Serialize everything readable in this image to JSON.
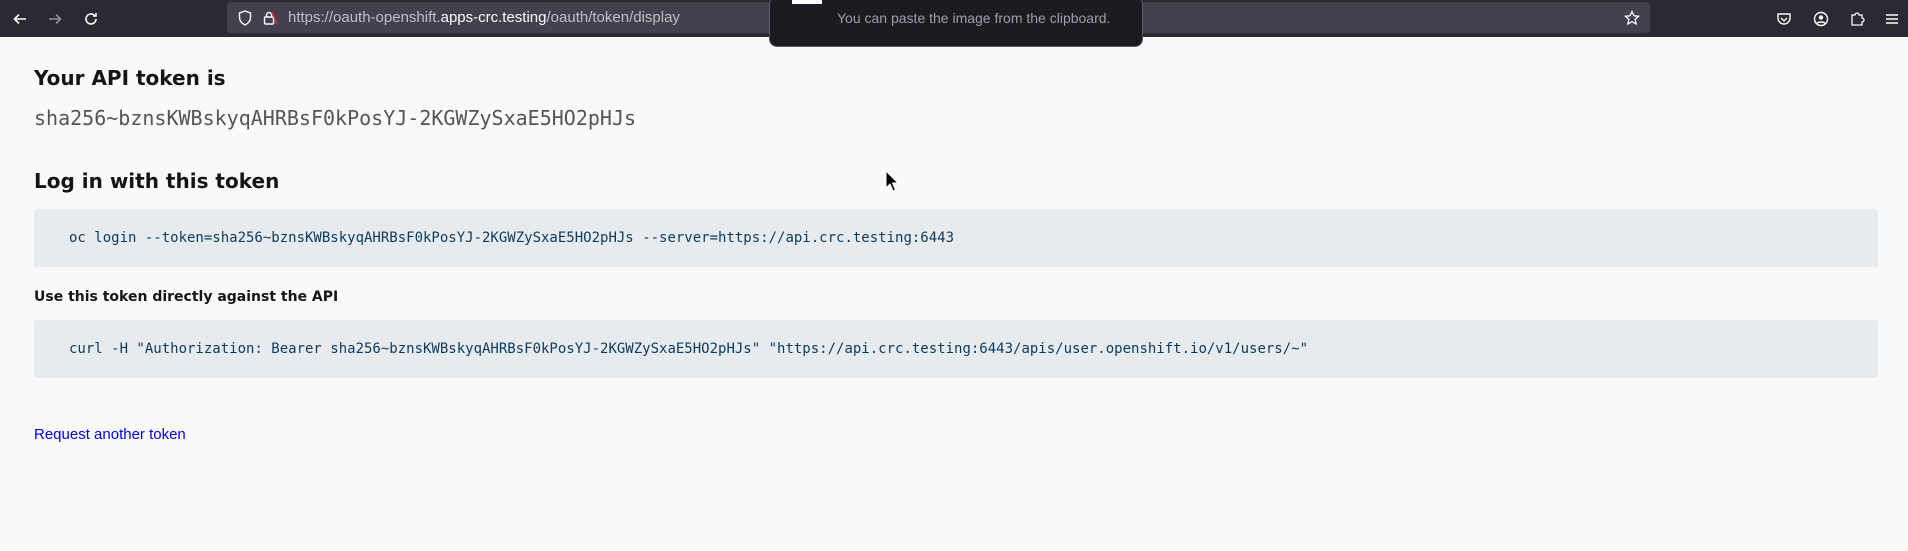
{
  "browser": {
    "url_prefix": "https://oauth-openshift.",
    "url_host": "apps-crc.testing",
    "url_path": "/oauth/token/display",
    "icons": {
      "back": "arrow-left-icon",
      "forward": "arrow-right-icon",
      "reload": "reload-icon",
      "tracking": "shield-icon",
      "lock": "lock-icon",
      "bookmark": "star-icon",
      "pocket": "pocket-icon",
      "account": "account-icon",
      "extensions": "puzzle-icon",
      "menu": "hamburger-menu-icon"
    }
  },
  "notification": {
    "text": "You can paste the image from the clipboard."
  },
  "page": {
    "token_heading": "Your API token is",
    "token_value": "sha256~bznsKWBskyqAHRBsF0kPosYJ-2KGWZySxaE5HO2pHJs",
    "login_heading": "Log in with this token",
    "login_command": "oc login --token=sha256~bznsKWBskyqAHRBsF0kPosYJ-2KGWZySxaE5HO2pHJs --server=https://api.crc.testing:6443",
    "api_heading": "Use this token directly against the API",
    "curl_command": "curl -H \"Authorization: Bearer sha256~bznsKWBskyqAHRBsF0kPosYJ-2KGWZySxaE5HO2pHJs\" \"https://api.crc.testing:6443/apis/user.openshift.io/v1/users/~\"",
    "request_link": "Request another token"
  },
  "colors": {
    "toolbar_bg": "#2b2a33",
    "urlbar_bg": "#42414d",
    "page_bg": "#f9f9f9",
    "code_bg": "#e8ebee",
    "code_text": "#0b3a5f",
    "link": "#0000ee"
  }
}
